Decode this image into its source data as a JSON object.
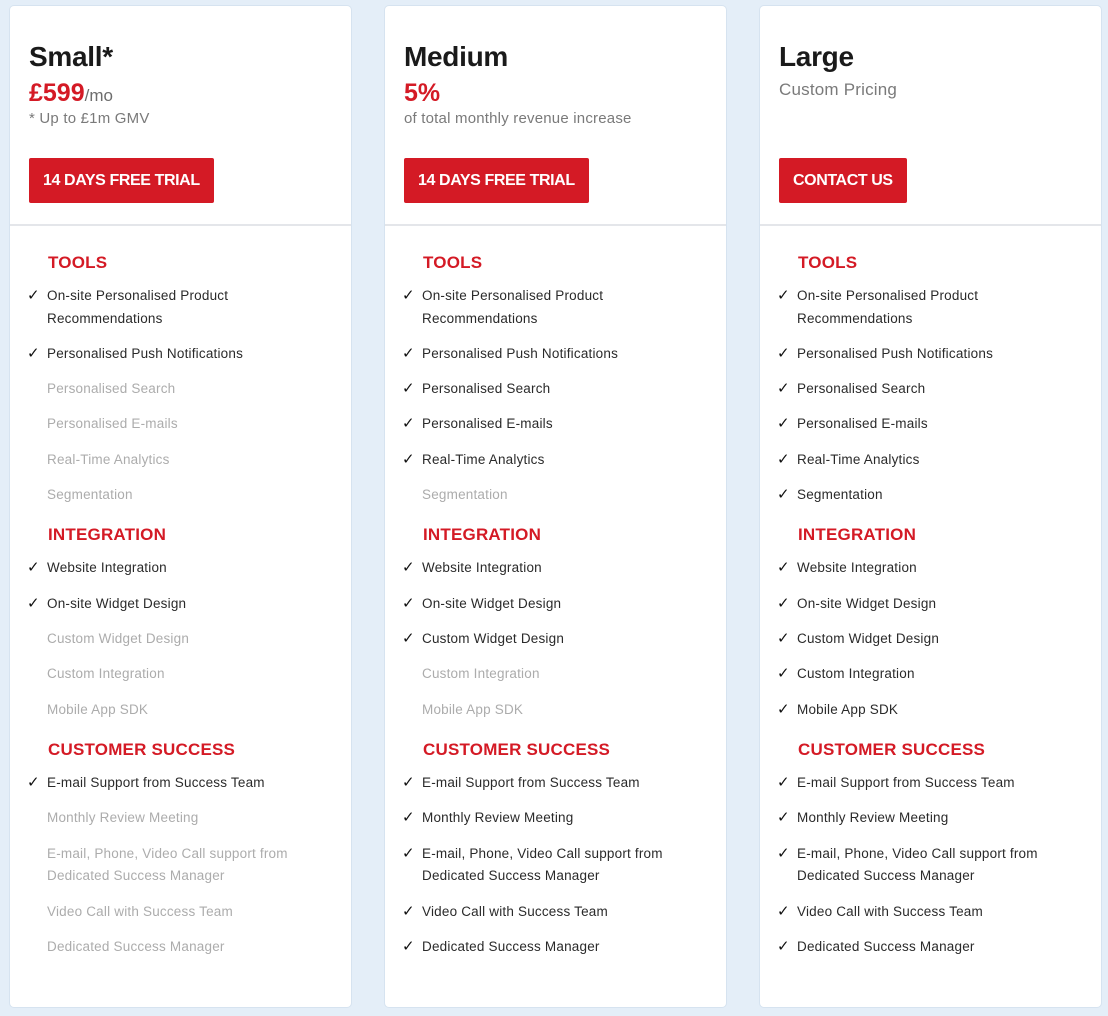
{
  "accent_color": "#d41a25",
  "plans": [
    {
      "name": "Small*",
      "price": "£599",
      "price_suffix": "/mo",
      "subtitle": "",
      "note": "* Up to £1m GMV",
      "cta_label": "14 DAYS FREE TRIAL",
      "sections": [
        {
          "title": "TOOLS",
          "features": [
            {
              "label": "On-site Personalised Product Recommendations",
              "included": true
            },
            {
              "label": "Personalised Push Notifications",
              "included": true
            },
            {
              "label": "Personalised Search",
              "included": false
            },
            {
              "label": "Personalised E-mails",
              "included": false
            },
            {
              "label": "Real-Time Analytics",
              "included": false
            },
            {
              "label": "Segmentation",
              "included": false
            }
          ]
        },
        {
          "title": "INTEGRATION",
          "features": [
            {
              "label": "Website Integration",
              "included": true
            },
            {
              "label": "On-site Widget Design",
              "included": true
            },
            {
              "label": "Custom Widget Design",
              "included": false
            },
            {
              "label": "Custom Integration",
              "included": false
            },
            {
              "label": "Mobile App SDK",
              "included": false
            }
          ]
        },
        {
          "title": "CUSTOMER SUCCESS",
          "features": [
            {
              "label": "E-mail Support from Success Team",
              "included": true
            },
            {
              "label": "Monthly Review Meeting",
              "included": false
            },
            {
              "label": "E-mail, Phone, Video Call support from Dedicated Success Manager",
              "included": false
            },
            {
              "label": "Video Call with Success Team",
              "included": false
            },
            {
              "label": "Dedicated Success Manager",
              "included": false
            }
          ]
        }
      ]
    },
    {
      "name": "Medium",
      "price": "5%",
      "price_suffix": "",
      "subtitle": "",
      "note": "of total monthly revenue increase",
      "cta_label": "14 DAYS FREE TRIAL",
      "sections": [
        {
          "title": "TOOLS",
          "features": [
            {
              "label": "On-site Personalised Product Recommendations",
              "included": true
            },
            {
              "label": "Personalised Push Notifications",
              "included": true
            },
            {
              "label": "Personalised Search",
              "included": true
            },
            {
              "label": "Personalised E-mails",
              "included": true
            },
            {
              "label": "Real-Time Analytics",
              "included": true
            },
            {
              "label": "Segmentation",
              "included": false
            }
          ]
        },
        {
          "title": "INTEGRATION",
          "features": [
            {
              "label": "Website Integration",
              "included": true
            },
            {
              "label": "On-site Widget Design",
              "included": true
            },
            {
              "label": "Custom Widget Design",
              "included": true
            },
            {
              "label": "Custom Integration",
              "included": false
            },
            {
              "label": "Mobile App SDK",
              "included": false
            }
          ]
        },
        {
          "title": "CUSTOMER SUCCESS",
          "features": [
            {
              "label": "E-mail Support from Success Team",
              "included": true
            },
            {
              "label": "Monthly Review Meeting",
              "included": true
            },
            {
              "label": "E-mail, Phone, Video Call support from Dedicated Success Manager",
              "included": true
            },
            {
              "label": "Video Call with Success Team",
              "included": true
            },
            {
              "label": "Dedicated Success Manager",
              "included": true
            }
          ]
        }
      ]
    },
    {
      "name": "Large",
      "price": "",
      "price_suffix": "",
      "subtitle": "Custom Pricing",
      "note": "",
      "cta_label": "CONTACT US",
      "sections": [
        {
          "title": "TOOLS",
          "features": [
            {
              "label": "On-site Personalised Product Recommendations",
              "included": true
            },
            {
              "label": "Personalised Push Notifications",
              "included": true
            },
            {
              "label": "Personalised Search",
              "included": true
            },
            {
              "label": "Personalised E-mails",
              "included": true
            },
            {
              "label": "Real-Time Analytics",
              "included": true
            },
            {
              "label": "Segmentation",
              "included": true
            }
          ]
        },
        {
          "title": "INTEGRATION",
          "features": [
            {
              "label": "Website Integration",
              "included": true
            },
            {
              "label": "On-site Widget Design",
              "included": true
            },
            {
              "label": "Custom Widget Design",
              "included": true
            },
            {
              "label": "Custom Integration",
              "included": true
            },
            {
              "label": "Mobile App SDK",
              "included": true
            }
          ]
        },
        {
          "title": "CUSTOMER SUCCESS",
          "features": [
            {
              "label": "E-mail Support from Success Team",
              "included": true
            },
            {
              "label": "Monthly Review Meeting",
              "included": true
            },
            {
              "label": "E-mail, Phone, Video Call support from Dedicated Success Manager",
              "included": true
            },
            {
              "label": "Video Call with Success Team",
              "included": true
            },
            {
              "label": "Dedicated Success Manager",
              "included": true
            }
          ]
        }
      ]
    }
  ],
  "icons": {
    "check": "✓"
  }
}
